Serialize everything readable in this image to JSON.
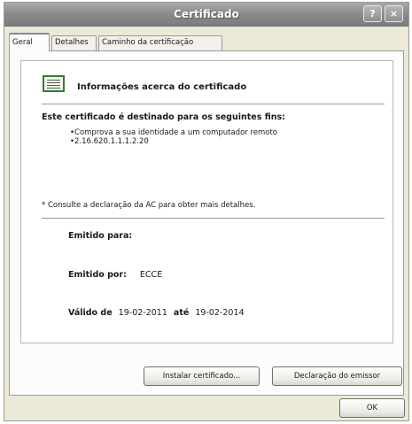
{
  "window": {
    "title": "Certificado",
    "help_button": "?",
    "close_button": "×"
  },
  "tabs": [
    {
      "label": "Geral",
      "active": true
    },
    {
      "label": "Detalhes",
      "active": false
    },
    {
      "label": "Caminho da certificação",
      "active": false
    }
  ],
  "info": {
    "title": "Informações acerca do certificado",
    "icon": "certificate-icon",
    "purpose_heading": "Este certificado é destinado para os seguintes fins:",
    "purposes": [
      "•Comprova a sua identidade a um computador remoto",
      "•2.16.620.1.1.1.2.20"
    ],
    "note": "* Consulte a declaração da AC para obter mais detalhes.",
    "issued_to_label": "Emitido para:",
    "issued_to_value": "",
    "issued_by_label": "Emitido por:",
    "issued_by_value": "ECCE",
    "valid_from_label": "Válido de",
    "valid_from_value": "19-02-2011",
    "valid_to_label": "até",
    "valid_to_value": "19-02-2014"
  },
  "buttons": {
    "install": "Instalar certificado...",
    "issuer_statement": "Declaração do emissor",
    "ok": "OK"
  },
  "colors": {
    "titlebar": "#8a8a8a",
    "dialog_bg": "#ece9d8",
    "icon_green": "#2e7d32"
  }
}
